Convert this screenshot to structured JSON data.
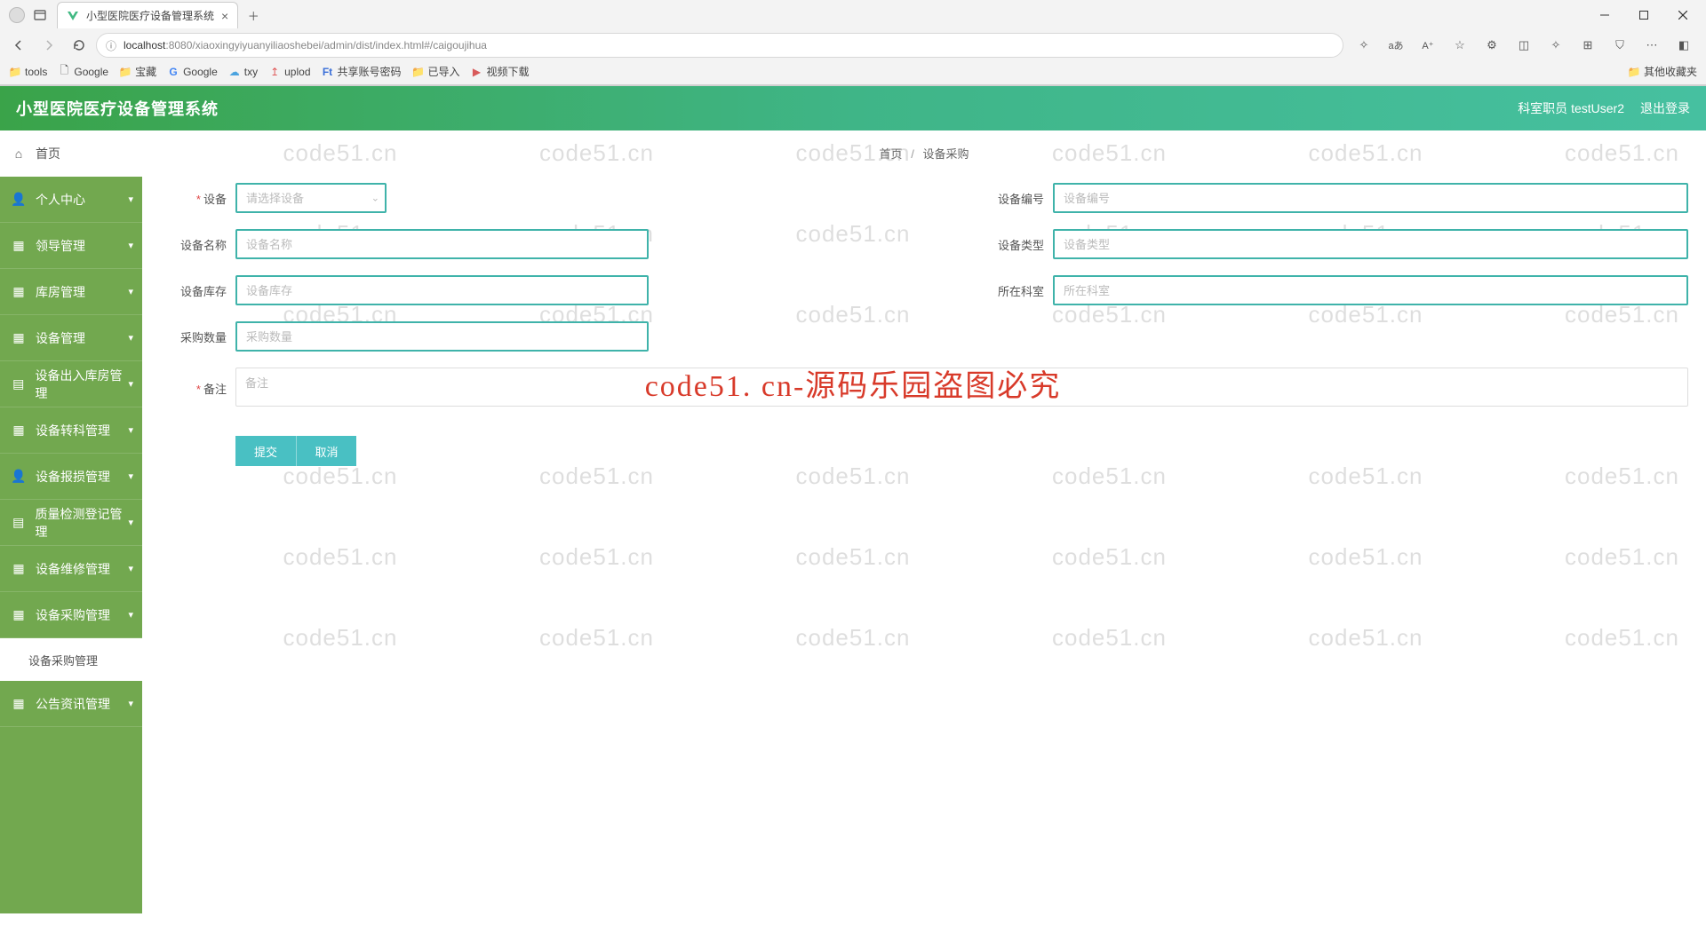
{
  "browser": {
    "tab_title": "小型医院医疗设备管理系统",
    "url_host": "localhost",
    "url_port": ":8080",
    "url_path": "/xiaoxingyiyuanyiliaoshebei/admin/dist/index.html#/caigoujihua",
    "bookmarks": [
      {
        "label": "tools",
        "icon": "folder"
      },
      {
        "label": "Google",
        "icon": "page"
      },
      {
        "label": "宝藏",
        "icon": "folder"
      },
      {
        "label": "Google",
        "icon": "g"
      },
      {
        "label": "txy",
        "icon": "cloud"
      },
      {
        "label": "uplod",
        "icon": "up"
      },
      {
        "label": "共享账号密码",
        "icon": "ft"
      },
      {
        "label": "已导入",
        "icon": "folder"
      },
      {
        "label": "视频下载",
        "icon": "dl"
      }
    ],
    "other_bookmarks": "其他收藏夹"
  },
  "header": {
    "title": "小型医院医疗设备管理系统",
    "user_role": "科室职员",
    "user_name": "testUser2",
    "logout": "退出登录"
  },
  "sidebar": {
    "items": [
      {
        "label": "首页",
        "icon": "home"
      },
      {
        "label": "个人中心",
        "icon": "user"
      },
      {
        "label": "领导管理",
        "icon": "grid"
      },
      {
        "label": "库房管理",
        "icon": "grid"
      },
      {
        "label": "设备管理",
        "icon": "grid"
      },
      {
        "label": "设备出入库房管理",
        "icon": "list"
      },
      {
        "label": "设备转科管理",
        "icon": "grid"
      },
      {
        "label": "设备报损管理",
        "icon": "user"
      },
      {
        "label": "质量检测登记管理",
        "icon": "list"
      },
      {
        "label": "设备维修管理",
        "icon": "grid"
      },
      {
        "label": "设备采购管理",
        "icon": "grid"
      },
      {
        "label": "公告资讯管理",
        "icon": "grid"
      }
    ],
    "active_sub": "设备采购管理"
  },
  "breadcrumb": {
    "home": "首页",
    "current": "设备采购"
  },
  "form": {
    "device": {
      "label": "设备",
      "placeholder": "请选择设备",
      "required": true
    },
    "device_number": {
      "label": "设备编号",
      "placeholder": "设备编号"
    },
    "device_name": {
      "label": "设备名称",
      "placeholder": "设备名称"
    },
    "device_type": {
      "label": "设备类型",
      "placeholder": "设备类型"
    },
    "device_stock": {
      "label": "设备库存",
      "placeholder": "设备库存"
    },
    "department": {
      "label": "所在科室",
      "placeholder": "所在科室"
    },
    "purchase_qty": {
      "label": "采购数量",
      "placeholder": "采购数量"
    },
    "remark": {
      "label": "备注",
      "placeholder": "备注",
      "required": true
    }
  },
  "buttons": {
    "submit": "提交",
    "cancel": "取消"
  },
  "watermark": {
    "text": "code51.cn",
    "banner": "code51. cn-源码乐园盗图必究"
  }
}
